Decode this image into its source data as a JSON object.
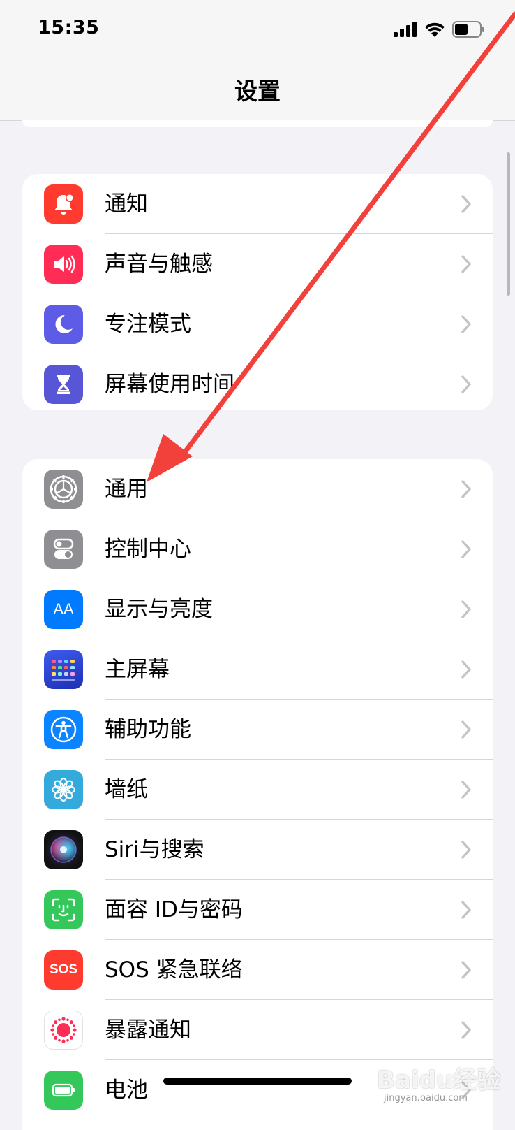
{
  "status_bar": {
    "time": "15:35",
    "icons": [
      "cellular-signal-icon",
      "wifi-icon",
      "battery-icon"
    ]
  },
  "nav": {
    "title": "设置"
  },
  "groups": [
    {
      "items": [
        {
          "label": "通知",
          "icon": "notifications-icon",
          "color": "#ff3b30"
        },
        {
          "label": "声音与触感",
          "icon": "sound-icon",
          "color": "#ff2d55"
        },
        {
          "label": "专注模式",
          "icon": "moon-icon",
          "color": "#5e5ce6"
        },
        {
          "label": "屏幕使用时间",
          "icon": "hourglass-icon",
          "color": "#5856d6"
        }
      ]
    },
    {
      "items": [
        {
          "label": "通用",
          "icon": "gear-icon",
          "color": "#8e8e93"
        },
        {
          "label": "控制中心",
          "icon": "toggles-icon",
          "color": "#8e8e93"
        },
        {
          "label": "显示与亮度",
          "icon": "text-size-icon",
          "color": "#007aff",
          "glyph": "AA"
        },
        {
          "label": "主屏幕",
          "icon": "home-screen-grid-icon",
          "color": "#2c4bd6"
        },
        {
          "label": "辅助功能",
          "icon": "accessibility-icon",
          "color": "#0a84ff"
        },
        {
          "label": "墙纸",
          "icon": "flower-icon",
          "color": "#34aadc"
        },
        {
          "label": "Siri与搜索",
          "icon": "siri-icon",
          "color": "#1c1c28"
        },
        {
          "label": "面容 ID与密码",
          "icon": "face-id-icon",
          "color": "#34c759"
        },
        {
          "label": "SOS 紧急联络",
          "icon": "sos-icon",
          "color": "#ff3b30",
          "glyph": "SOS"
        },
        {
          "label": "暴露通知",
          "icon": "exposure-notification-icon",
          "color": "#ffffff"
        },
        {
          "label": "电池",
          "icon": "battery-settings-icon",
          "color": "#34c759"
        }
      ]
    }
  ],
  "annotation": {
    "arrow_color": "#f2403b"
  },
  "watermark": {
    "text": "Baidu经验",
    "sub": "jingyan.baidu.com"
  }
}
